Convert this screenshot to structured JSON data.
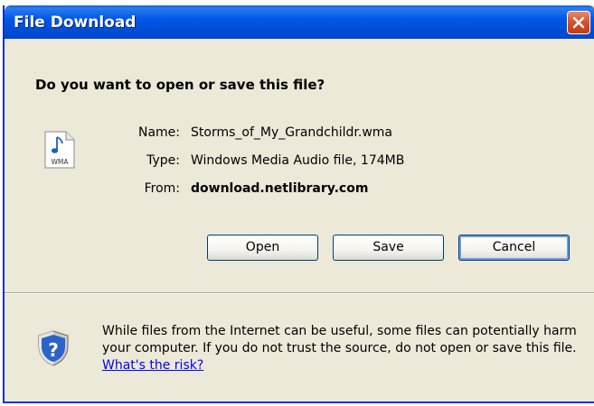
{
  "window": {
    "title": "File Download"
  },
  "question": "Do you want to open or save this file?",
  "file": {
    "icon": "wma-file-icon",
    "icon_text": "WMA",
    "name_label": "Name:",
    "name": "Storms_of_My_Grandchildr.wma",
    "type_label": "Type:",
    "type": "Windows Media Audio file, 174MB",
    "from_label": "From:",
    "from": "download.netlibrary.com"
  },
  "buttons": {
    "open": "Open",
    "save": "Save",
    "cancel": "Cancel"
  },
  "warning": {
    "icon": "shield-question-icon",
    "text": "While files from the Internet can be useful, some files can potentially harm your computer. If you do not trust the source, do not open or save this file.",
    "link": "What's the risk?"
  },
  "colors": {
    "titlebar": "#0058e6",
    "background": "#ece9d8",
    "close": "#d8532d",
    "link": "#0000ff"
  }
}
